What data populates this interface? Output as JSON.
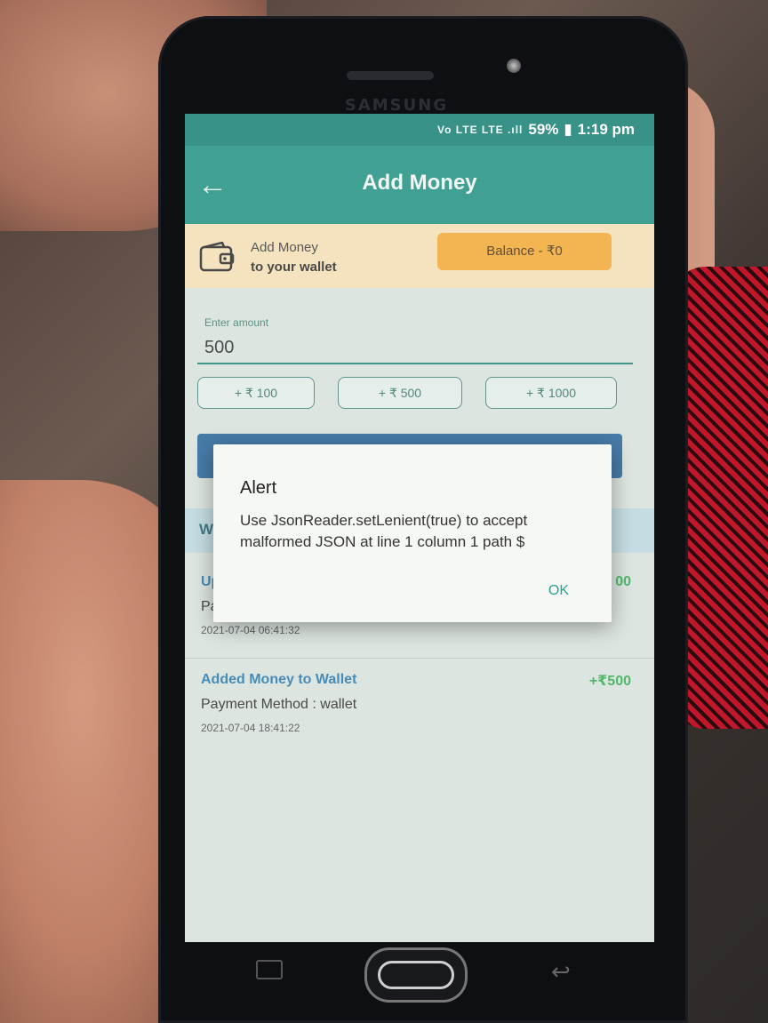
{
  "device": {
    "brand": "SAMSUNG"
  },
  "status_bar": {
    "icons": "Vo LTE LTE .ıll",
    "battery": "59%",
    "time": "1:19 pm"
  },
  "app_bar": {
    "title": "Add Money",
    "back_icon": "back-arrow-icon"
  },
  "banner": {
    "line1": "Add Money",
    "line2": "to your wallet",
    "balance": "Balance - ₹0",
    "icon": "wallet-icon"
  },
  "amount": {
    "label": "Enter amount",
    "value": "500"
  },
  "quick_amounts": [
    "+ ₹ 100",
    "+ ₹ 500",
    "+ ₹ 1000"
  ],
  "section": {
    "header_partial": "W"
  },
  "transactions": [
    {
      "title": "Up",
      "amount": "00",
      "method": "Pa",
      "time": "2021-07-04 06:41:32"
    },
    {
      "title": "Added Money to Wallet",
      "amount": "+₹500",
      "method": "Payment Method : wallet",
      "time": "2021-07-04 18:41:22"
    }
  ],
  "dialog": {
    "title": "Alert",
    "message": "Use JsonReader.setLenient(true) to accept malformed JSON at line 1 column 1 path $",
    "ok_label": "OK"
  },
  "colors": {
    "status_bar": "#0d7a6d",
    "app_bar": "#168c7c",
    "banner_bg": "#f3dcb0",
    "balance_chip": "#f0a52c",
    "primary_button": "#1f5f95",
    "accent_green": "#2ea84a",
    "link_blue": "#1f73a8",
    "ok_teal": "#2aa397"
  }
}
